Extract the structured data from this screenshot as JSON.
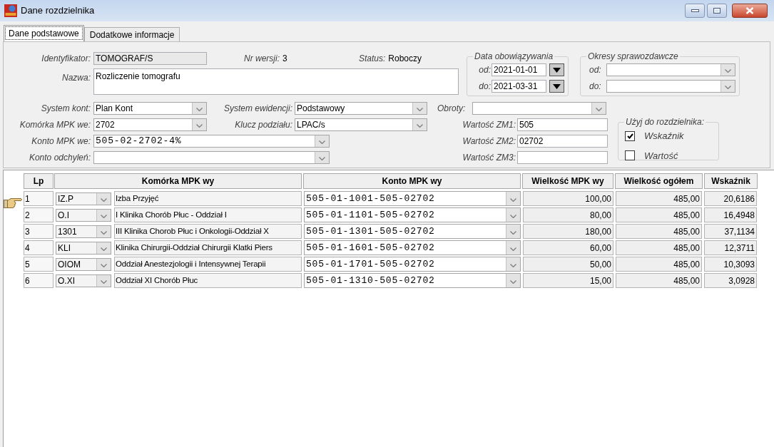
{
  "window": {
    "title": "Dane rozdzielnika"
  },
  "tabs": [
    {
      "label": "Dane podstawowe",
      "selected": true
    },
    {
      "label": "Dodatkowe informacje",
      "selected": false
    }
  ],
  "header": {
    "identyfikator": {
      "label": "Identyfikator:",
      "value": "TOMOGRAF/S"
    },
    "nr_wersji": {
      "label": "Nr wersji:",
      "value": "3"
    },
    "status": {
      "label": "Status:",
      "value": "Roboczy"
    },
    "nazwa": {
      "label": "Nazwa:",
      "value": "Rozliczenie tomografu"
    }
  },
  "data_obowiazywania": {
    "title": "Data obowiązywania",
    "od": {
      "label": "od:",
      "value": "2021-01-01"
    },
    "do": {
      "label": "do:",
      "value": "2021-03-31"
    }
  },
  "okresy_sprawozdawcze": {
    "title": "Okresy sprawozdawcze",
    "od": {
      "label": "od:"
    },
    "do": {
      "label": "do:"
    }
  },
  "settings": {
    "system_kont": {
      "label": "System kont:",
      "value": "Plan Kont"
    },
    "system_ewidencji": {
      "label": "System ewidencji:",
      "value": "Podstawowy"
    },
    "komorka_mpk_we": {
      "label": "Komórka MPK we:",
      "value": "2702"
    },
    "klucz_podzialu": {
      "label": "Klucz podziału:",
      "value": "LPAC/s"
    },
    "konto_mpk_we": {
      "label": "Konto MPK we:",
      "value": "505-02-2702-4%"
    },
    "konto_odchylen": {
      "label": "Konto odchyleń:"
    }
  },
  "obroty": {
    "label": "Obroty:"
  },
  "wartosci_zm": [
    {
      "label": "Wartość ZM1:",
      "value": "505"
    },
    {
      "label": "Wartość ZM2:",
      "value": "02702"
    },
    {
      "label": "Wartość ZM3:"
    }
  ],
  "uzyj_do_rozdzielnika": {
    "title": "Użyj do rozdzielnika:",
    "options": [
      {
        "label": "Wskaźnik",
        "checked": true
      },
      {
        "label": "Wartość",
        "checked": false
      }
    ]
  },
  "table": {
    "columns": [
      "Lp",
      "Komórka MPK wy",
      "Konto MPK wy",
      "Wielkość MPK wy",
      "Wielkość ogółem",
      "Wskaźnik"
    ],
    "rows": [
      {
        "lp": "1",
        "komorka_code": "IZ.P",
        "komorka_name": "Izba Przyjęć",
        "konto": "505-01-1001-505-02702",
        "wielkosc_mpk_wy": "100,00",
        "wielkosc_ogolem": "485,00",
        "wskaznik": "20,6186",
        "selected": true
      },
      {
        "lp": "2",
        "komorka_code": "O.I",
        "komorka_name": "I Klinika Chorób Płuc - Oddział I",
        "konto": "505-01-1101-505-02702",
        "wielkosc_mpk_wy": "80,00",
        "wielkosc_ogolem": "485,00",
        "wskaznik": "16,4948",
        "selected": false
      },
      {
        "lp": "3",
        "komorka_code": "1301",
        "komorka_name": "III Klinika Chorob Płuc i Onkologii-Oddział X",
        "konto": "505-01-1301-505-02702",
        "wielkosc_mpk_wy": "180,00",
        "wielkosc_ogolem": "485,00",
        "wskaznik": "37,1134",
        "selected": false
      },
      {
        "lp": "4",
        "komorka_code": "KLI",
        "komorka_name": "Klinika Chirurgii-Oddział Chirurgii Klatki Piers",
        "konto": "505-01-1601-505-02702",
        "wielkosc_mpk_wy": "60,00",
        "wielkosc_ogolem": "485,00",
        "wskaznik": "12,3711",
        "selected": false
      },
      {
        "lp": "5",
        "komorka_code": "OIOM",
        "komorka_name": "Oddział Anestezjologii i Intensywnej Terapii",
        "konto": "505-01-1701-505-02702",
        "wielkosc_mpk_wy": "50,00",
        "wielkosc_ogolem": "485,00",
        "wskaznik": "10,3093",
        "selected": false
      },
      {
        "lp": "6",
        "komorka_code": "O.XI",
        "komorka_name": "Oddział XI Chorób Płuc",
        "konto": "505-01-1310-505-02702",
        "wielkosc_mpk_wy": "15,00",
        "wielkosc_ogolem": "485,00",
        "wskaznik": "3,0928",
        "selected": false
      }
    ]
  }
}
